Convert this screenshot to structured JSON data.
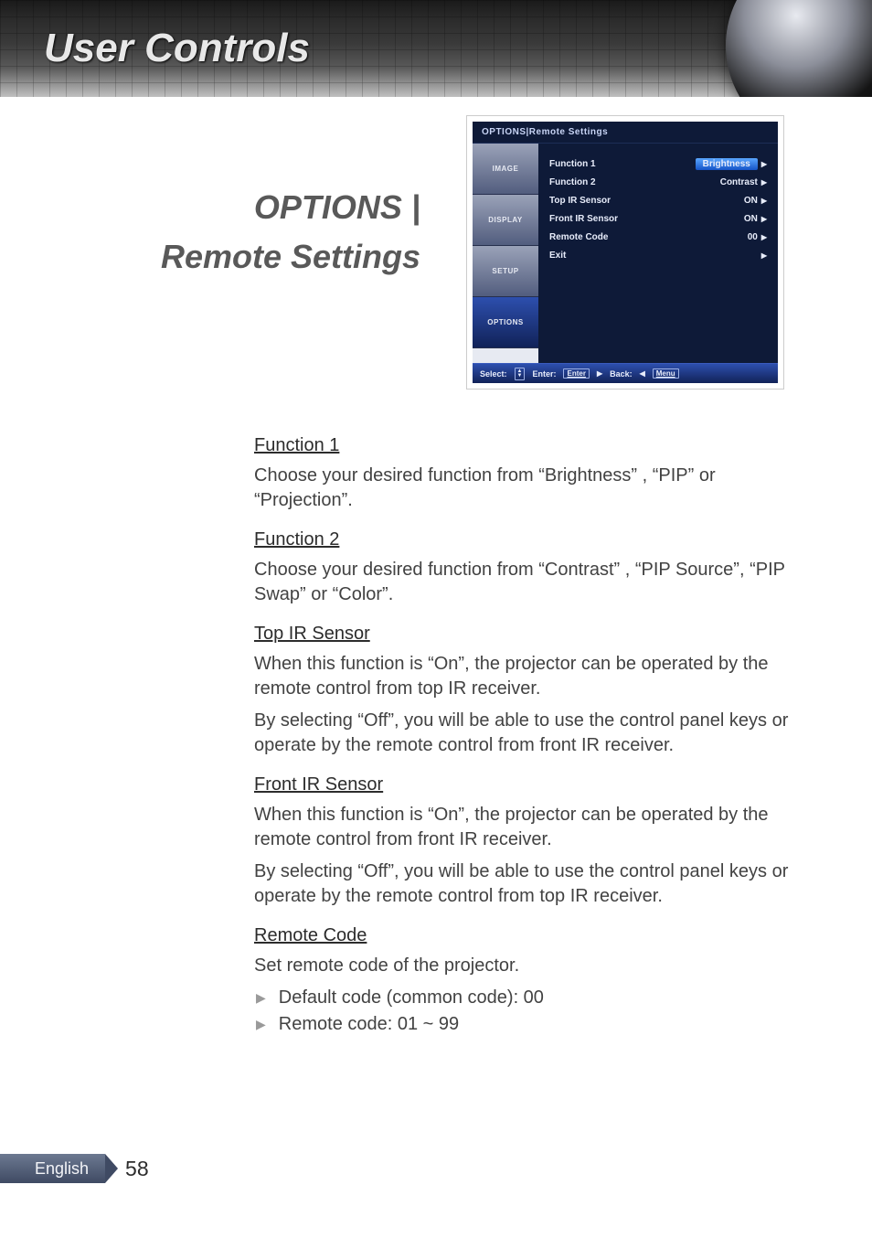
{
  "header": {
    "title": "User Controls"
  },
  "section": {
    "line1": "OPTIONS |",
    "line2": "Remote Settings"
  },
  "osd": {
    "breadcrumb": "OPTIONS|Remote Settings",
    "tabs": [
      "IMAGE",
      "DISPLAY",
      "SETUP",
      "OPTIONS"
    ],
    "active_tab_index": 3,
    "rows": [
      {
        "label": "Function 1",
        "value": "Brightness",
        "highlight": true
      },
      {
        "label": "Function 2",
        "value": "Contrast"
      },
      {
        "label": "Top IR Sensor",
        "value": "ON"
      },
      {
        "label": "Front IR Sensor",
        "value": "ON"
      },
      {
        "label": "Remote Code",
        "value": "00"
      },
      {
        "label": "Exit",
        "value": ""
      }
    ],
    "footer": {
      "select_label": "Select:",
      "enter_label": "Enter:",
      "enter_key": "Enter",
      "back_label": "Back:",
      "back_key": "Menu"
    }
  },
  "content": {
    "s1": {
      "h": "Function 1",
      "p1": "Choose your desired function from “Brightness” , “PIP” or “Projection”."
    },
    "s2": {
      "h": "Function 2",
      "p1": "Choose your desired function from “Contrast” , “PIP Source”, “PIP Swap” or “Color”."
    },
    "s3": {
      "h": "Top IR Sensor",
      "p1": "When this function is “On”, the projector can be operated by the remote control from top IR receiver.",
      "p2": "By selecting “Off”, you will be able to use the control panel keys or operate by the remote control from front IR receiver."
    },
    "s4": {
      "h": "Front IR Sensor",
      "p1": "When this function is “On”, the projector can be operated by the remote control from front IR receiver.",
      "p2": "By selecting “Off”, you will be able to use the control panel keys or operate by the remote control from top IR receiver."
    },
    "s5": {
      "h": "Remote Code",
      "p1": "Set remote code of the projector.",
      "b1": "Default code (common code): 00",
      "b2": "Remote code: 01 ~ 99"
    }
  },
  "footer": {
    "language": "English",
    "page": "58"
  }
}
